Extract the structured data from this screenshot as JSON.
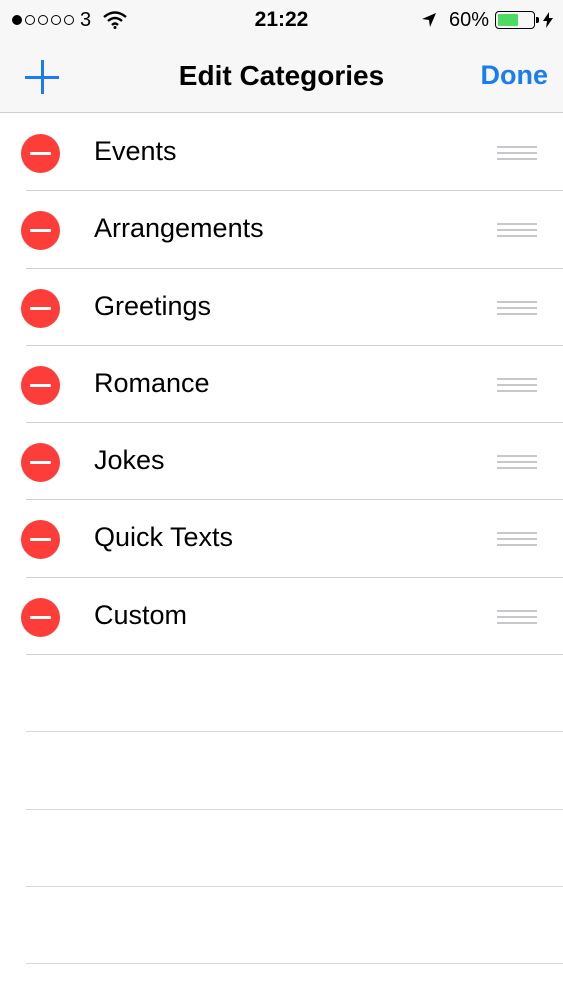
{
  "status_bar": {
    "signal_dots_filled": 1,
    "signal_dots_total": 5,
    "carrier": "3",
    "time": "21:22",
    "battery_percent": "60%",
    "battery_level": 0.6,
    "icons": [
      "wifi-icon",
      "location-arrow-icon",
      "battery-icon",
      "charging-bolt-icon"
    ]
  },
  "nav": {
    "title": "Edit Categories",
    "add_icon": "plus-icon",
    "done_label": "Done",
    "accent_color": "#1a7cf0"
  },
  "categories": [
    {
      "label": "Events"
    },
    {
      "label": "Arrangements"
    },
    {
      "label": "Greetings"
    },
    {
      "label": "Romance"
    },
    {
      "label": "Jokes"
    },
    {
      "label": "Quick Texts"
    },
    {
      "label": "Custom"
    }
  ],
  "colors": {
    "delete": "#fc3d39",
    "battery": "#4cd964",
    "separator": "#cfcfd2"
  }
}
